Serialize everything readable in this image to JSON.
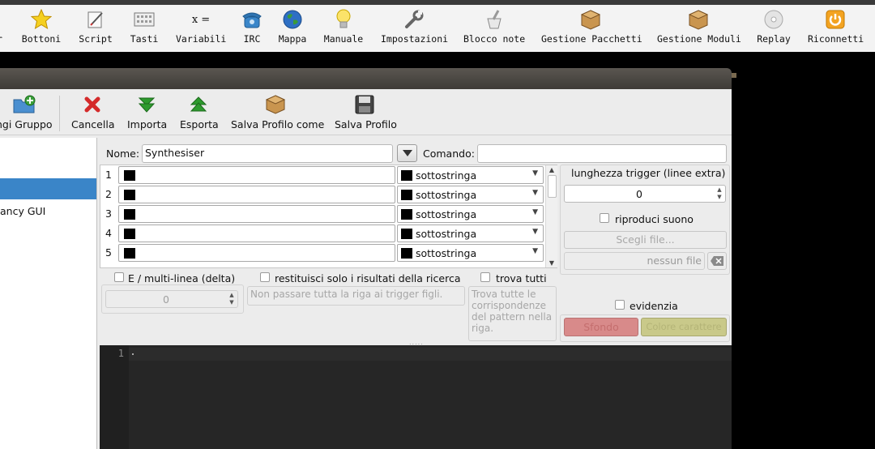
{
  "main_toolbar": {
    "items": [
      {
        "label": "r",
        "icon": "partial-icon"
      },
      {
        "label": "Bottoni",
        "icon": "star-icon"
      },
      {
        "label": "Script",
        "icon": "script-pen-icon"
      },
      {
        "label": "Tasti",
        "icon": "keyboard-icon"
      },
      {
        "label": "Variabili",
        "icon": "variables-icon",
        "icon_text": "x ="
      },
      {
        "label": "IRC",
        "icon": "telephone-icon"
      },
      {
        "label": "Mappa",
        "icon": "globe-icon"
      },
      {
        "label": "Manuale",
        "icon": "lightbulb-icon"
      },
      {
        "label": "Impostazioni",
        "icon": "wrench-icon"
      },
      {
        "label": "Blocco note",
        "icon": "mortar-pestle-icon"
      },
      {
        "label": "Gestione Pacchetti",
        "icon": "package-p-icon",
        "icon_text": "P"
      },
      {
        "label": "Gestione Moduli",
        "icon": "package-m-icon",
        "icon_text": "M"
      },
      {
        "label": "Replay",
        "icon": "cd-icon"
      },
      {
        "label": "Riconnetti",
        "icon": "power-icon"
      }
    ]
  },
  "editor_toolbar": {
    "items": [
      {
        "label": "ngi Gruppo",
        "icon": "add-group-icon"
      },
      {
        "label": "Cancella",
        "icon": "red-x-icon"
      },
      {
        "label": "Importa",
        "icon": "green-down-arrow-icon"
      },
      {
        "label": "Esporta",
        "icon": "green-up-arrow-icon"
      },
      {
        "label": "Salva Profilo come",
        "icon": "box-icon"
      },
      {
        "label": "Salva Profilo",
        "icon": "floppy-icon"
      }
    ]
  },
  "tree": {
    "item2": "ancy GUI"
  },
  "form": {
    "name_label": "Nome:",
    "name_value": "Synthesiser",
    "command_label": "Comando:",
    "command_value": ""
  },
  "patterns": [
    {
      "num": "1",
      "type": "sottostringa"
    },
    {
      "num": "2",
      "type": "sottostringa"
    },
    {
      "num": "3",
      "type": "sottostringa"
    },
    {
      "num": "4",
      "type": "sottostringa"
    },
    {
      "num": "5",
      "type": "sottostringa"
    }
  ],
  "right_panel": {
    "length_label": "lunghezza trigger (linee extra)",
    "length_value": "0",
    "sound_label": "riproduci suono",
    "choose_file": "Scegli file...",
    "no_file": "nessun file",
    "highlight_label": "evidenzia",
    "background_btn": "Sfondo",
    "foreground_btn": "Colore carattere"
  },
  "options": {
    "multiline_label": "E / multi-linea (delta)",
    "multiline_value": "0",
    "filter_label": "restituisci solo i risultati della ricerca",
    "filter_placeholder": "Non passare tutta la riga ai trigger figli.",
    "match_all_label": "trova tutti",
    "match_all_placeholder": "Trova tutte le corrispondenze del pattern nella riga."
  },
  "editor": {
    "line1": "1"
  },
  "colors": {
    "selection": "#3a85c8",
    "editor_bg": "#262626",
    "sfondo_btn": "#d88a8a",
    "fore_btn": "#c9c98a"
  }
}
